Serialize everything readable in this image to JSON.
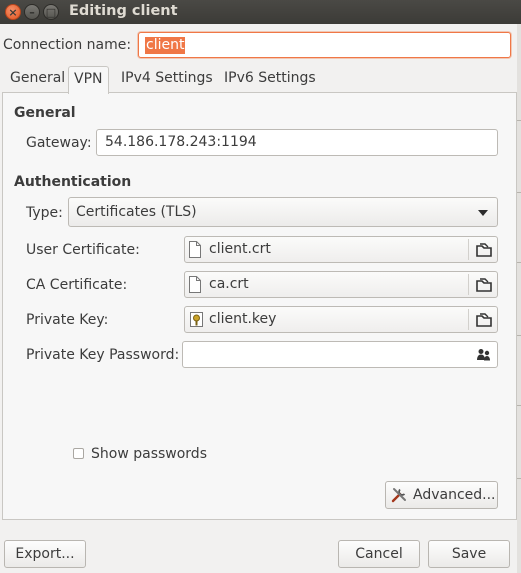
{
  "window": {
    "title": "Editing client",
    "buttons": {
      "close": "×",
      "minimize": "–",
      "maximize": "□"
    }
  },
  "connection": {
    "label": "Connection name:",
    "value": "client"
  },
  "tabs": [
    {
      "label": "General",
      "active": false
    },
    {
      "label": "VPN",
      "active": true
    },
    {
      "label": "IPv4 Settings",
      "active": false
    },
    {
      "label": "IPv6 Settings",
      "active": false
    }
  ],
  "general": {
    "heading": "General",
    "gateway_label": "Gateway:",
    "gateway_value": "54.186.178.243:1194"
  },
  "authentication": {
    "heading": "Authentication",
    "type_label": "Type:",
    "type_value": "Certificates (TLS)",
    "user_cert_label": "User Certificate:",
    "user_cert_value": "client.crt",
    "ca_cert_label": "CA Certificate:",
    "ca_cert_value": "ca.crt",
    "private_key_label": "Private Key:",
    "private_key_value": "client.key",
    "private_key_password_label": "Private Key Password:",
    "private_key_password_value": ""
  },
  "show_passwords": {
    "label": "Show passwords",
    "checked": false
  },
  "buttons": {
    "advanced": "Advanced...",
    "export": "Export...",
    "cancel": "Cancel",
    "save": "Save"
  },
  "icons": {
    "file": "file-icon",
    "key_file": "key-file-icon",
    "open_file": "open-file-icon",
    "password_storage": "password-storage-icon",
    "advanced": "tools-icon"
  },
  "colors": {
    "accent": "#f07746",
    "titlebar": "#3c3b37"
  }
}
